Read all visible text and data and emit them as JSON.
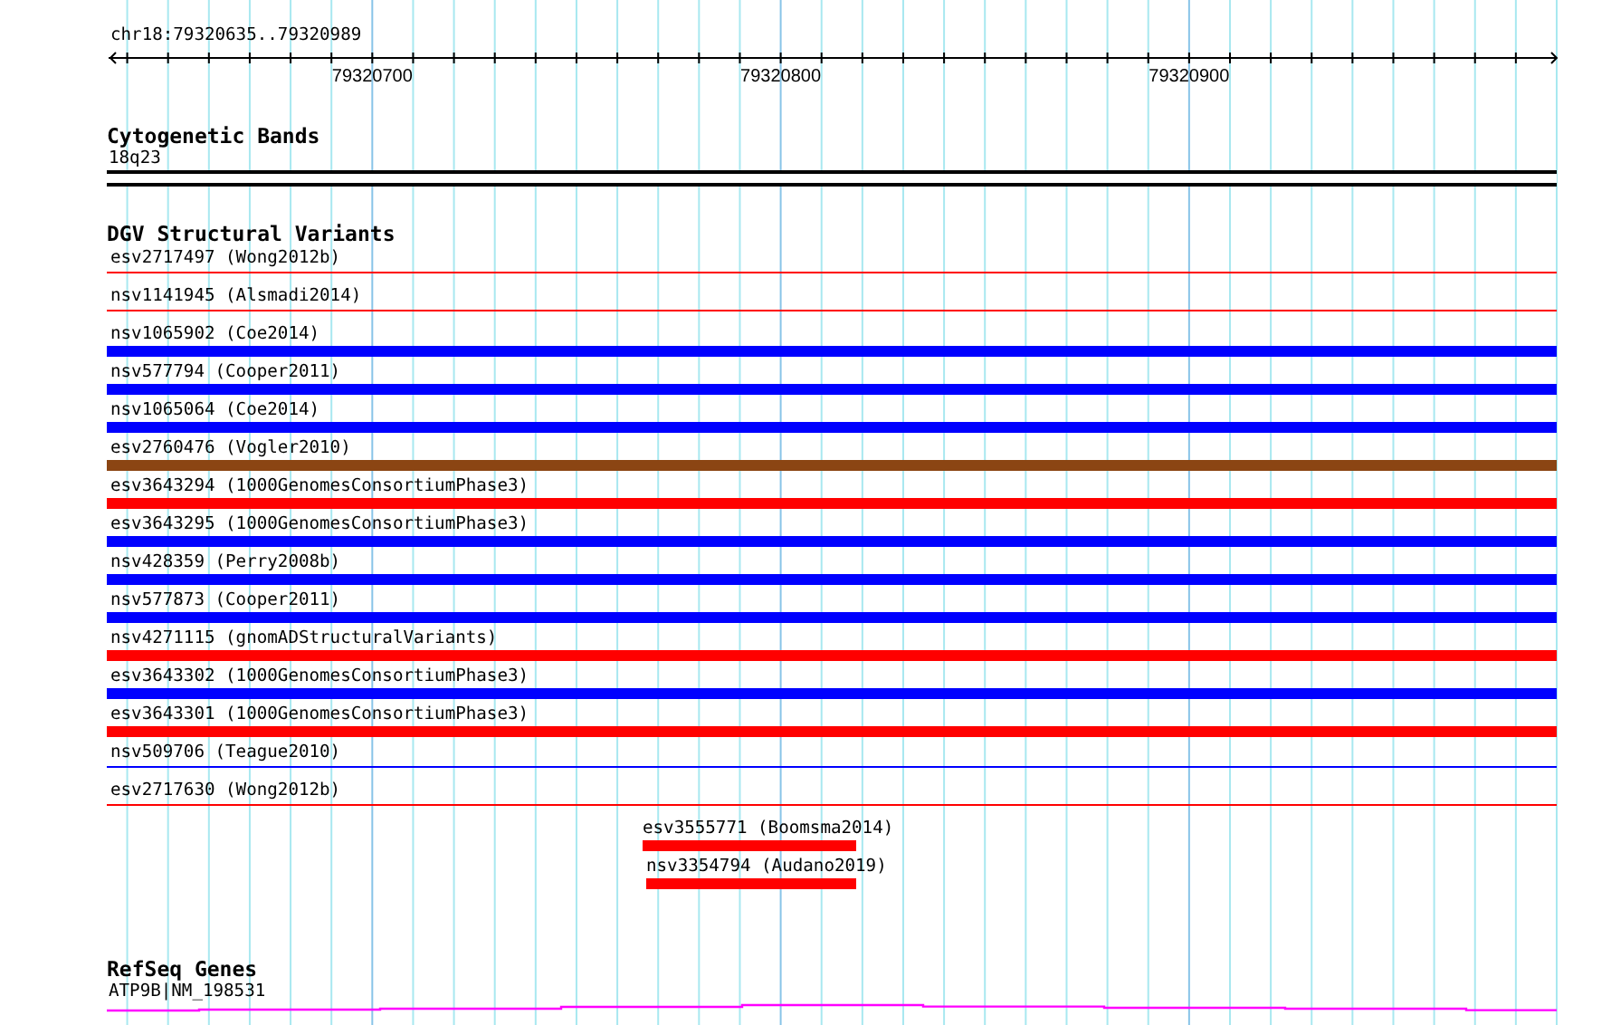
{
  "ruler": {
    "location": "chr18:79320635..79320989",
    "tick_labels": [
      "79320700",
      "79320800",
      "79320900"
    ]
  },
  "cytogenetic_bands": {
    "title": "Cytogenetic Bands",
    "band": "18q23"
  },
  "dgv": {
    "title": "DGV Structural Variants",
    "variants": [
      {
        "label": "esv2717497 (Wong2012b)",
        "color": "#ff0000",
        "kind": "thin"
      },
      {
        "label": "nsv1141945 (Alsmadi2014)",
        "color": "#ff0000",
        "kind": "thin"
      },
      {
        "label": "nsv1065902 (Coe2014)",
        "color": "#0000ff",
        "kind": "thick"
      },
      {
        "label": "nsv577794 (Cooper2011)",
        "color": "#0000ff",
        "kind": "thick"
      },
      {
        "label": "nsv1065064 (Coe2014)",
        "color": "#0000ff",
        "kind": "thick"
      },
      {
        "label": "esv2760476 (Vogler2010)",
        "color": "#8b4513",
        "kind": "thick"
      },
      {
        "label": "esv3643294 (1000GenomesConsortiumPhase3)",
        "color": "#ff0000",
        "kind": "thick"
      },
      {
        "label": "esv3643295 (1000GenomesConsortiumPhase3)",
        "color": "#0000ff",
        "kind": "thick"
      },
      {
        "label": "nsv428359 (Perry2008b)",
        "color": "#0000ff",
        "kind": "thick"
      },
      {
        "label": "nsv577873 (Cooper2011)",
        "color": "#0000ff",
        "kind": "thick"
      },
      {
        "label": "nsv4271115 (gnomADStructuralVariants)",
        "color": "#ff0000",
        "kind": "thick"
      },
      {
        "label": "esv3643302 (1000GenomesConsortiumPhase3)",
        "color": "#0000ff",
        "kind": "thick"
      },
      {
        "label": "esv3643301 (1000GenomesConsortiumPhase3)",
        "color": "#ff0000",
        "kind": "thick"
      },
      {
        "label": "nsv509706 (Teague2010)",
        "color": "#0000ff",
        "kind": "thin"
      },
      {
        "label": "esv2717630 (Wong2012b)",
        "color": "#ff0000",
        "kind": "thin"
      },
      {
        "label": "esv3555771 (Boomsma2014)",
        "color": "#ff0000",
        "kind": "partial"
      },
      {
        "label": "nsv3354794 (Audano2019)",
        "color": "#ff0000",
        "kind": "partial"
      }
    ]
  },
  "refseq": {
    "title": "RefSeq Genes",
    "gene": "ATP9B|NM_198531"
  }
}
